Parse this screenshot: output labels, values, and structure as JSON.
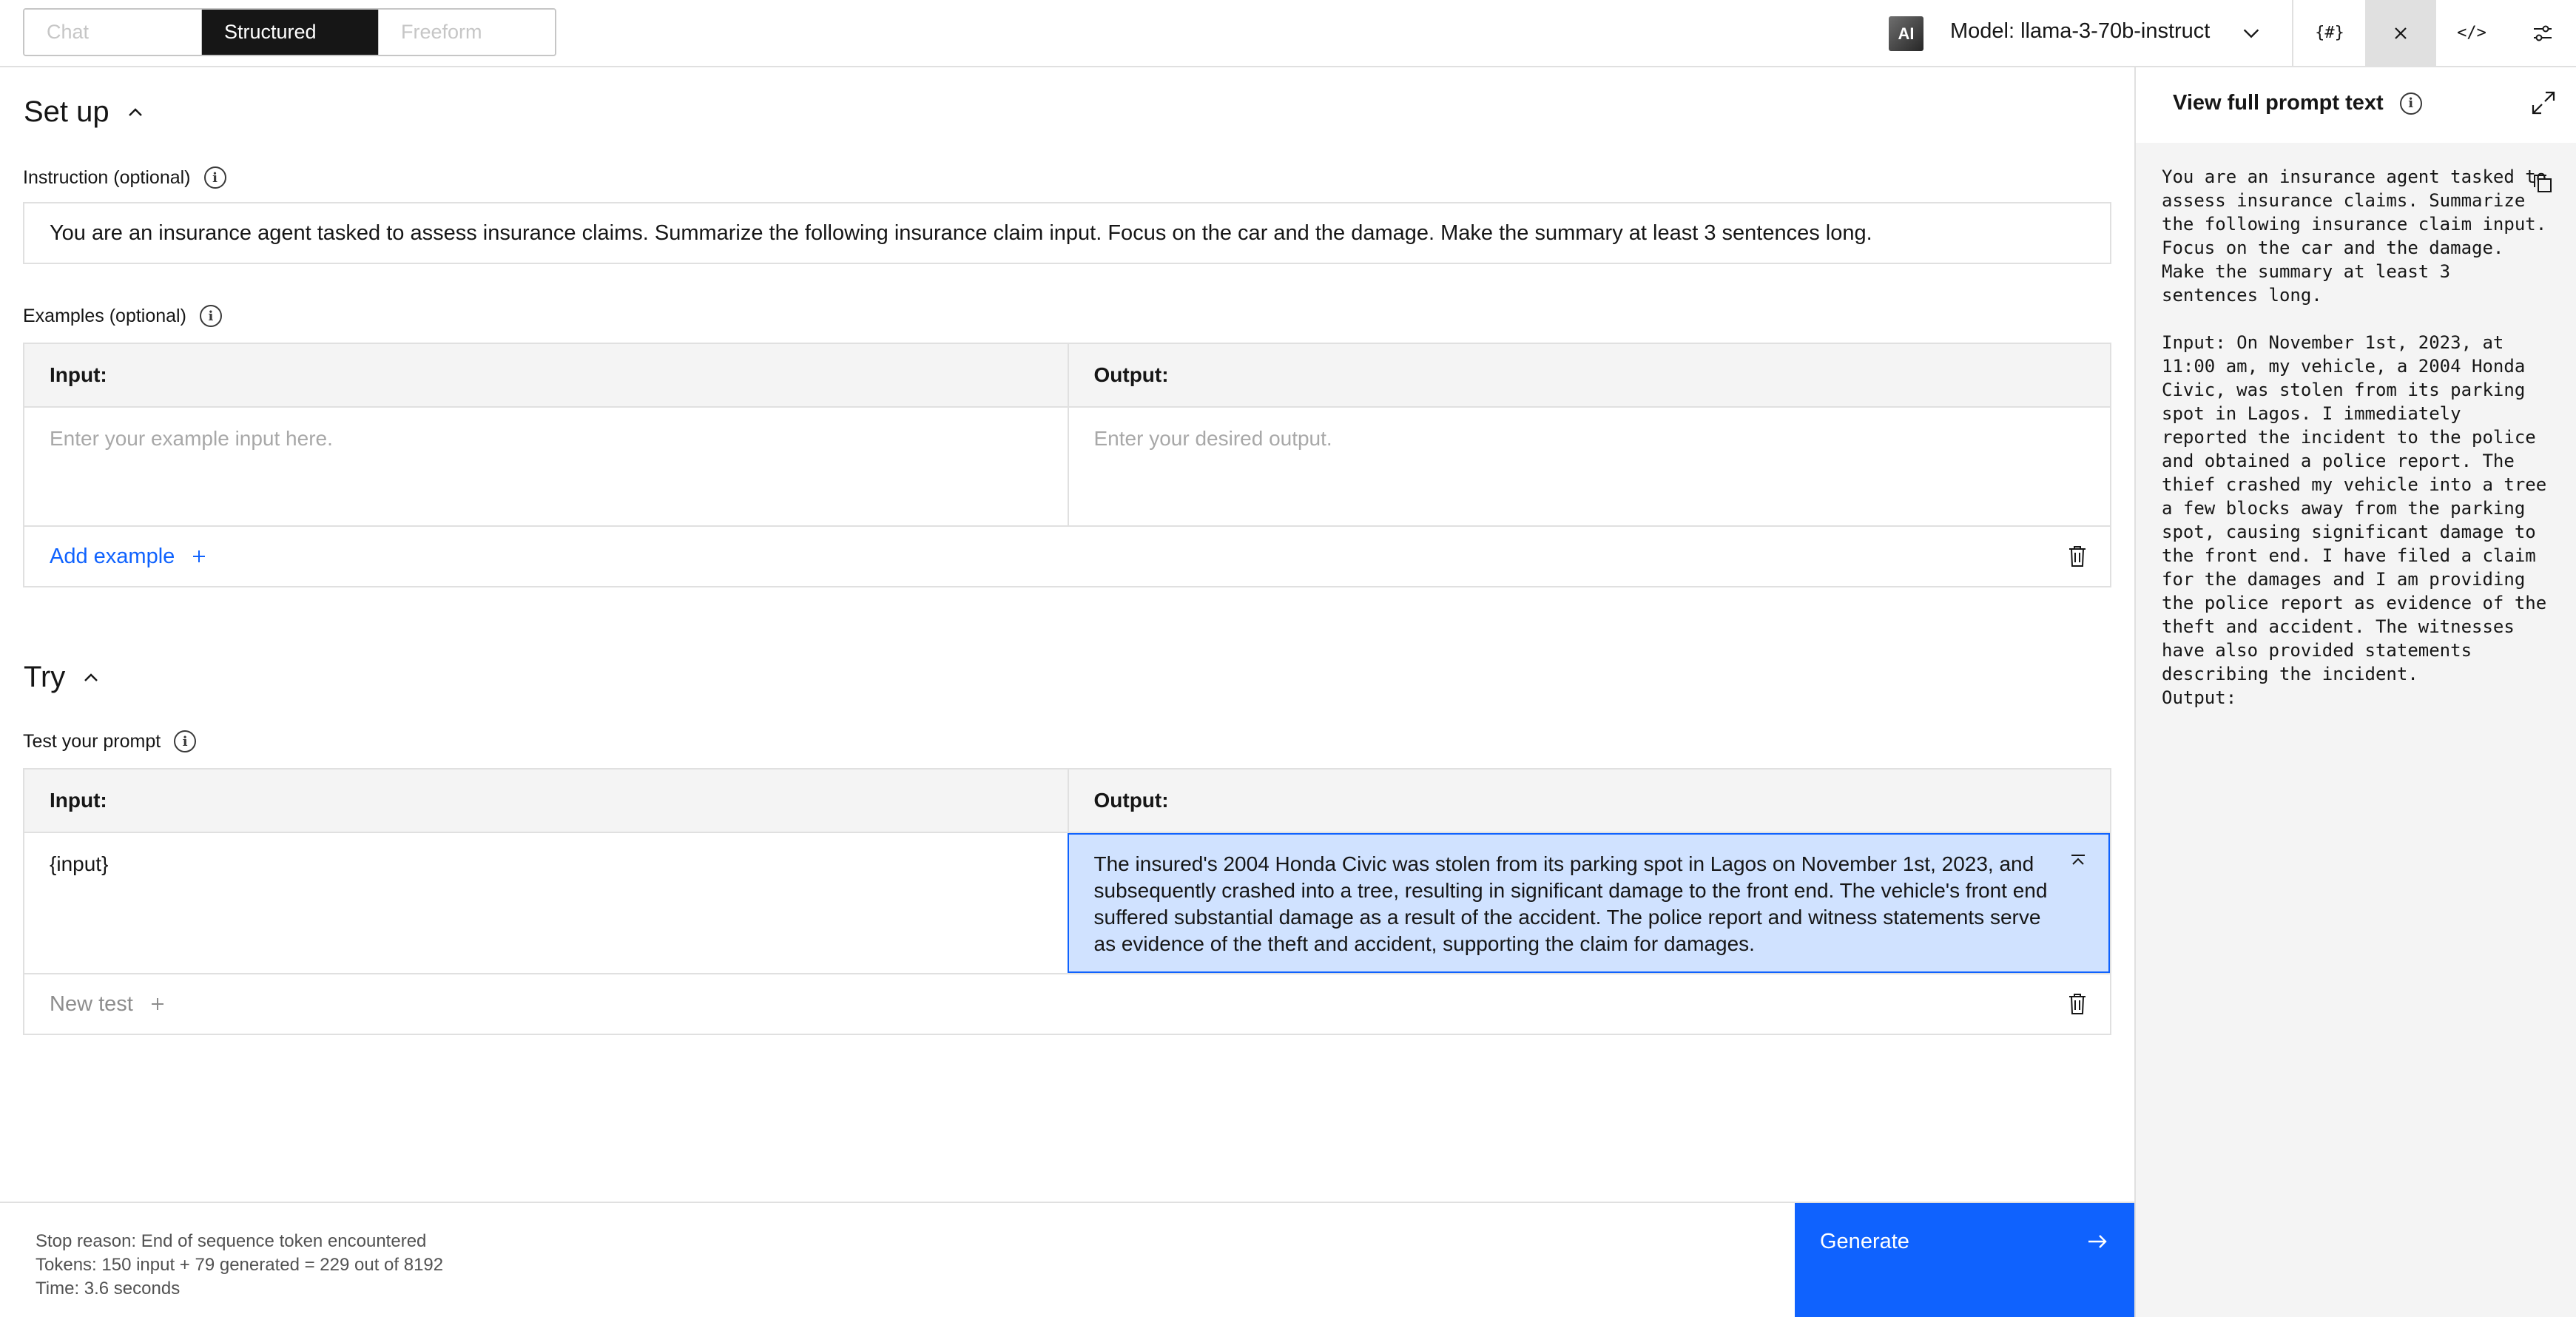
{
  "mode_tabs": [
    "Chat",
    "Structured",
    "Freeform"
  ],
  "model": {
    "badge": "AI",
    "label": "Model: llama-3-70b-instruct"
  },
  "toolbar": {
    "variables_label": "{#}",
    "code_label": "</>"
  },
  "setup": {
    "title": "Set up",
    "instruction_label": "Instruction (optional)",
    "instruction_value": "You are an insurance agent tasked to assess insurance claims. Summarize the following insurance claim input. Focus on the car and the damage. Make the summary at least 3 sentences long.",
    "examples_label": "Examples (optional)",
    "examples_table": {
      "input_header": "Input:",
      "output_header": "Output:",
      "input_placeholder": "Enter your example input here.",
      "output_placeholder": "Enter your desired output."
    },
    "add_example_label": "Add example"
  },
  "try": {
    "title": "Try",
    "test_label": "Test your prompt",
    "table": {
      "input_header": "Input:",
      "output_header": "Output:",
      "input_value": "{input}",
      "output_value": "The insured's 2004 Honda Civic was stolen from its parking spot in Lagos on November 1st, 2023, and subsequently crashed into a tree, resulting in significant damage to the front end. The vehicle's front end suffered substantial damage as a result of the accident. The police report and witness statements serve as evidence of the theft and accident, supporting the claim for damages."
    },
    "new_test_label": "New test"
  },
  "status": {
    "stop_reason": "Stop reason: End of sequence token encountered",
    "tokens": "Tokens: 150 input + 79 generated = 229 out of 8192",
    "time": "Time: 3.6 seconds"
  },
  "generate_label": "Generate",
  "panel": {
    "title": "View full prompt text",
    "prompt_text": "You are an insurance agent tasked to assess insurance claims. Summarize the following insurance claim input. Focus on the car and the damage. Make the summary at least 3 sentences long.\n\nInput: On November 1st, 2023, at 11:00 am, my vehicle, a 2004 Honda Civic, was stolen from its parking spot in Lagos. I immediately reported the incident to the police and obtained a police report. The thief crashed my vehicle into a tree a few blocks away from the parking spot, causing significant damage to the front end. I have filed a claim for the damages and I am providing the police report as evidence of the theft and accident. The witnesses have also provided statements describing the incident.\nOutput:"
  }
}
